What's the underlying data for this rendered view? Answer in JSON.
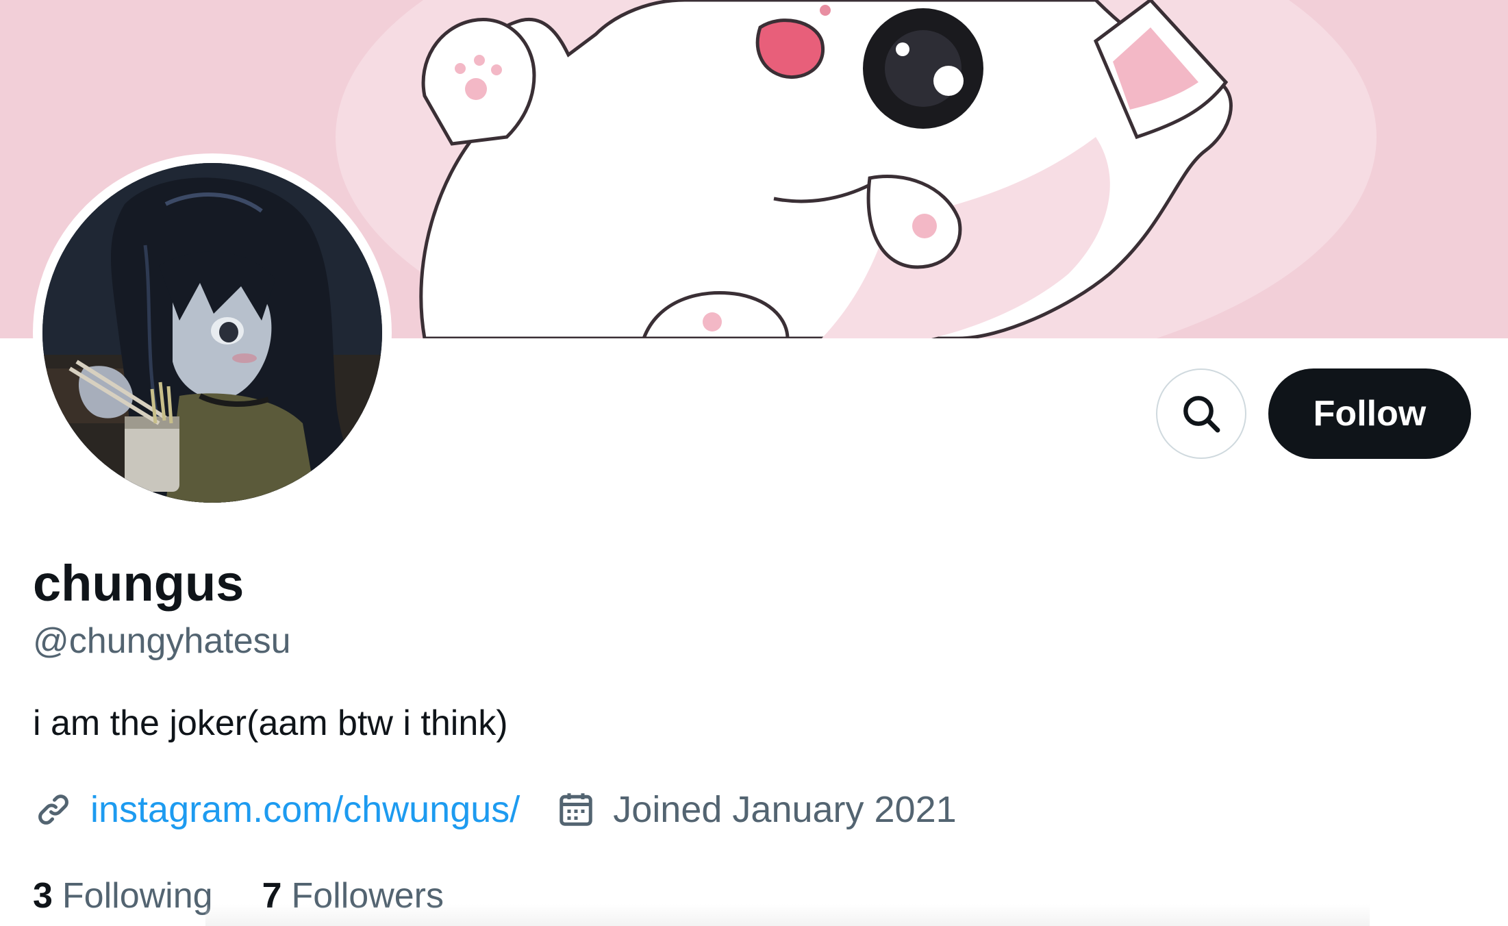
{
  "profile": {
    "display_name": "chungus",
    "handle": "@chungyhatesu",
    "bio": "i am the joker(aam btw i think)",
    "website": "instagram.com/chwungus/",
    "joined": "Joined January 2021"
  },
  "actions": {
    "follow_label": "Follow",
    "search_icon": "search-icon"
  },
  "stats": {
    "following_count": "3",
    "following_label": "Following",
    "followers_count": "7",
    "followers_label": "Followers"
  },
  "icons": {
    "link": "link-icon",
    "calendar": "calendar-icon"
  },
  "colors": {
    "link": "#1d9bf0",
    "secondary_text": "#536471",
    "primary_text": "#0f1419",
    "follow_button_bg": "#0f1419",
    "banner_pink": "#f1cdd6"
  }
}
